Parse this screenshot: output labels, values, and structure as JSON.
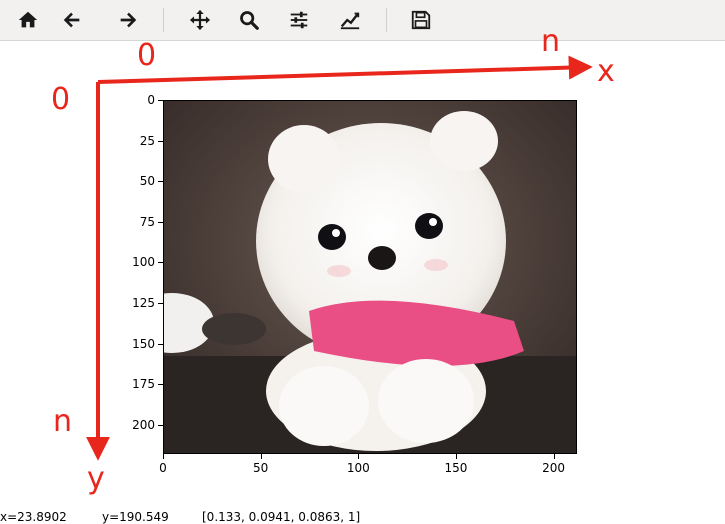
{
  "toolbar": {
    "buttons": [
      {
        "name": "home-button",
        "icon": "home-icon"
      },
      {
        "name": "back-button",
        "icon": "arrow-left-icon"
      },
      {
        "name": "forward-button",
        "icon": "arrow-right-icon"
      },
      {
        "name": "pan-button",
        "icon": "move-arrows-icon"
      },
      {
        "name": "zoom-button",
        "icon": "magnifier-icon"
      },
      {
        "name": "configure-subplots-button",
        "icon": "sliders-icon"
      },
      {
        "name": "edit-axis-button",
        "icon": "line-chart-icon"
      },
      {
        "name": "save-button",
        "icon": "floppy-disk-icon"
      }
    ]
  },
  "annotations": {
    "origin_top": "0",
    "origin_left": "0",
    "x_end": "n",
    "x_axis": "x",
    "y_end": "n",
    "y_axis": "y",
    "color": "#e8261b"
  },
  "axes": {
    "y_ticks": [
      "0",
      "25",
      "50",
      "75",
      "100",
      "125",
      "150",
      "175",
      "200"
    ],
    "x_ticks": [
      "0",
      "50",
      "100",
      "150",
      "200"
    ],
    "xlim": [
      0,
      212
    ],
    "ylim": [
      218,
      0
    ]
  },
  "image": {
    "subject": "white pomeranian puppy in pink shirt",
    "colors": {
      "background": "#3a2f2b",
      "fur": "#f7f5f2",
      "shirt": "#e94f85",
      "table": "#2a2523"
    }
  },
  "status": {
    "x_readout": "x=23.8902",
    "y_readout": "y=190.549",
    "pixel_value": "[0.133, 0.0941, 0.0863, 1]"
  }
}
